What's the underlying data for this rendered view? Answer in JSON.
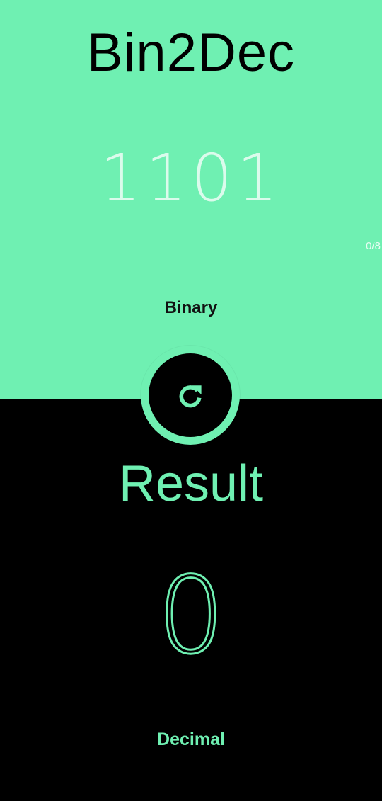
{
  "app": {
    "title": "Bin2Dec"
  },
  "binary_input": {
    "placeholder": "1101",
    "value": "",
    "counter": "0/8",
    "label": "Binary"
  },
  "reset_button": {
    "icon": "refresh-icon"
  },
  "result": {
    "title": "Result",
    "value": "0",
    "label": "Decimal"
  },
  "colors": {
    "accent": "#6ff0b2",
    "dark": "#000000"
  }
}
